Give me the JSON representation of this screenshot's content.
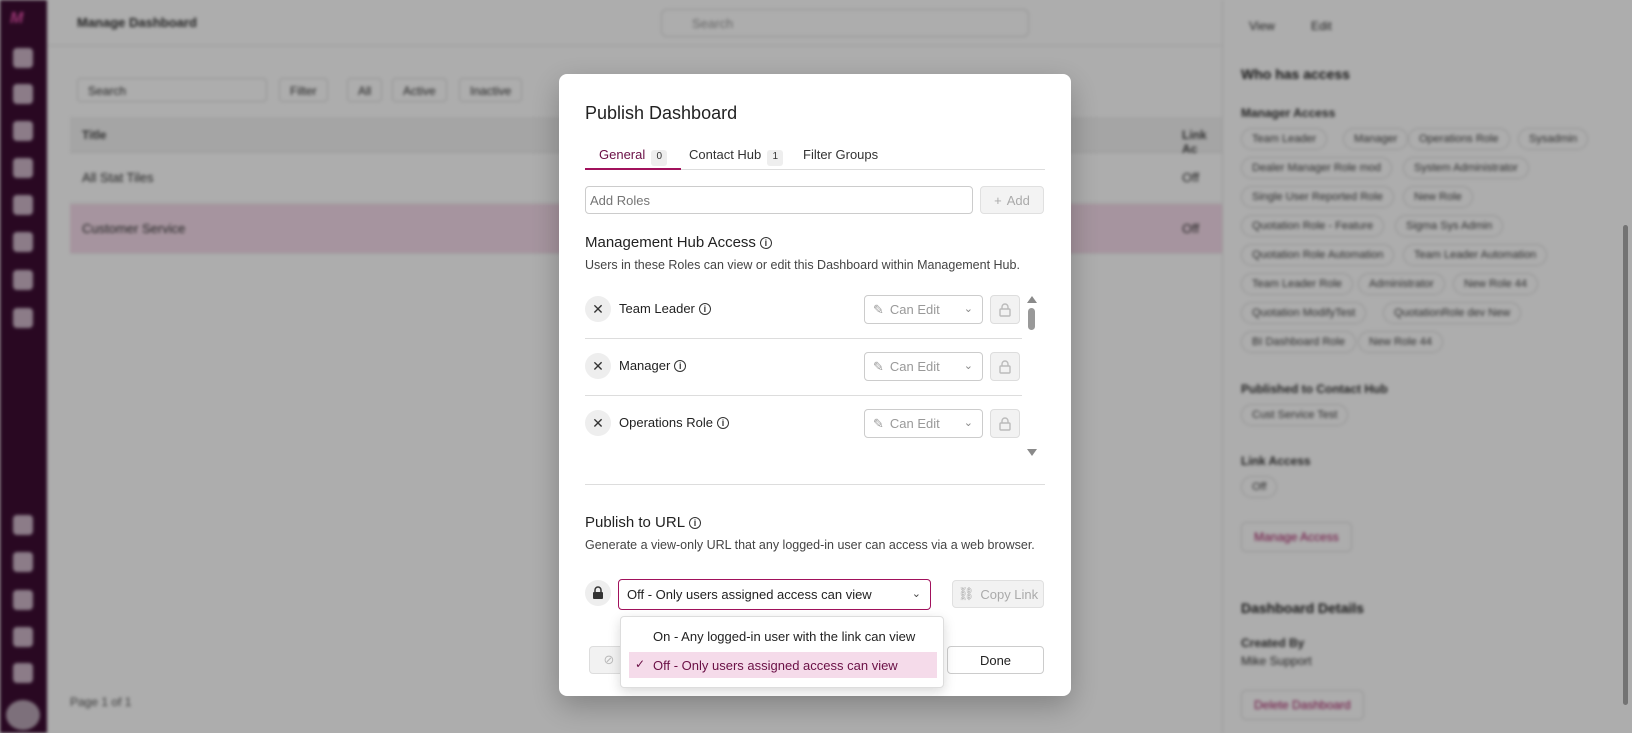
{
  "background": {
    "breadcrumb": "Manage Dashboard",
    "search_placeholder": "Search",
    "filter_chips": [
      "Search",
      "Filter",
      "All",
      "Active",
      "Inactive"
    ],
    "table_headers": [
      "Title",
      "Link Ac"
    ],
    "rows": [
      {
        "title": "All Stat Tiles",
        "access": "Off"
      },
      {
        "title": "Customer Service",
        "access": "Off"
      }
    ],
    "pager": {
      "label": "Page",
      "value": "1",
      "of": "of 1"
    },
    "right_panel": {
      "toolbar": [
        "View",
        "Edit"
      ],
      "who_title": "Who has access",
      "manager_access": "Manager Access",
      "chips": [
        "Team Leader",
        "Manager",
        "Operations Role",
        "Sysadmin",
        "Dealer Manager Role mod",
        "System Administrator",
        "Single User Reported Role",
        "New Role",
        "Quotation Role - Feature",
        "Sigma Sys Admin",
        "Quotation Role Automation",
        "Team Leader Automation",
        "Team Leader Role",
        "Administrator",
        "New Role 44",
        "Quotation ModifyTest",
        "QuotationRole dev New",
        "BI Dashboard Role",
        "New Role 44"
      ],
      "published_contact_hub": "Published to Contact Hub",
      "contact_chip": "Cust Service Test",
      "link_access": "Link Access",
      "link_chip": "Off",
      "manage_access": "Manage Access",
      "details_title": "Dashboard Details",
      "created_by": "Created By",
      "created_by_value": "Mike Support",
      "delete": "Delete Dashboard"
    }
  },
  "modal": {
    "title": "Publish Dashboard",
    "tabs": [
      {
        "label": "General",
        "badge": "0"
      },
      {
        "label": "Contact Hub",
        "badge": "1"
      },
      {
        "label": "Filter Groups"
      }
    ],
    "roles_input": {
      "placeholder": "Add Roles",
      "value": ""
    },
    "add_label": "Add",
    "management_hub": {
      "title": "Management Hub Access",
      "description": "Users in these Roles can view or edit this Dashboard within Management Hub.",
      "roles": [
        {
          "name": "Team Leader",
          "permission": "Can Edit"
        },
        {
          "name": "Manager",
          "permission": "Can Edit"
        },
        {
          "name": "Operations Role",
          "permission": "Can Edit"
        }
      ]
    },
    "publish_url": {
      "title": "Publish to URL",
      "description": "Generate a view-only URL that any logged-in user can access via a web browser.",
      "selected": "Off - Only users assigned access can view",
      "copy_label": "Copy Link",
      "options": [
        {
          "label": "On - Any logged-in user with the link can view",
          "selected": false
        },
        {
          "label": "Off - Only users assigned access can view",
          "selected": true
        }
      ]
    },
    "done_label": "Done"
  },
  "colors": {
    "accent": "#a1115c",
    "nav": "#3d0d33",
    "selected_bg": "#f5dbea"
  }
}
